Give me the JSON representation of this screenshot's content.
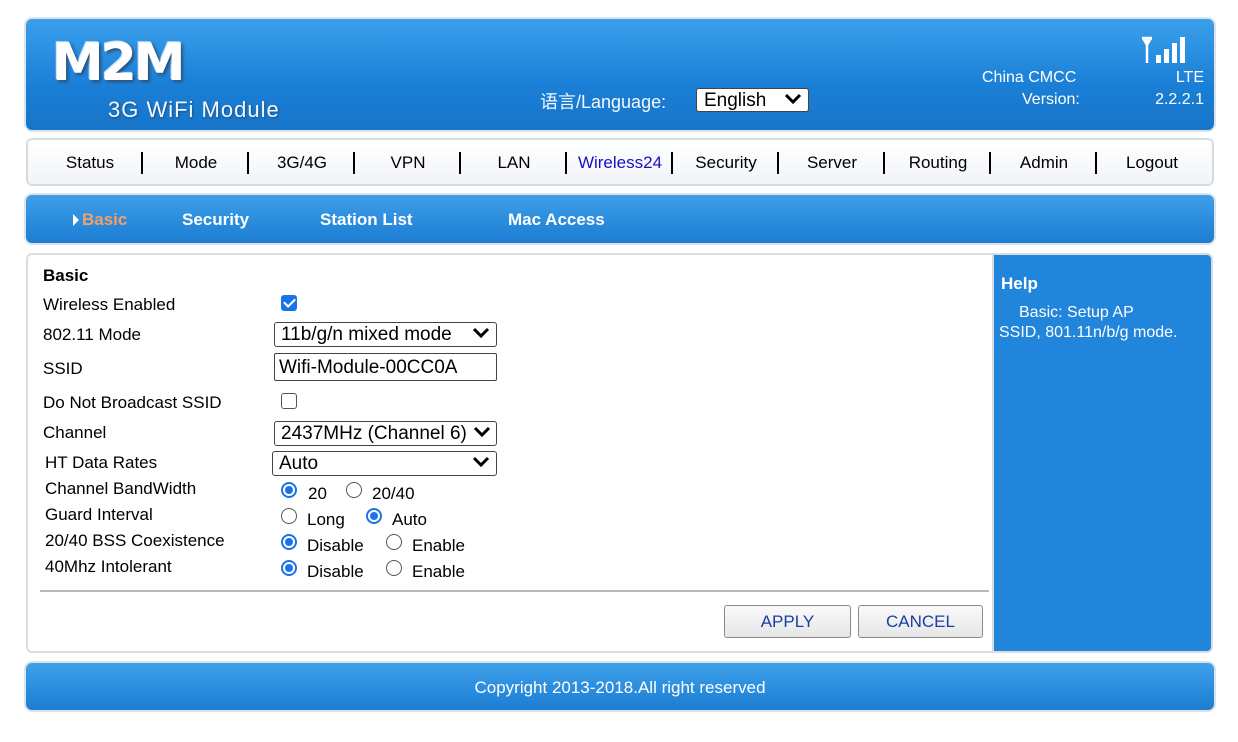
{
  "header": {
    "logo": "M2M",
    "subtitle": "3G WiFi Module",
    "language_label": "语言/Language:",
    "language_value": "English",
    "carrier": "China CMCC",
    "network": "LTE",
    "version_label": "Version:",
    "version_value": "2.2.2.1",
    "signal_icon": "signal-bars-icon"
  },
  "nav": {
    "items": [
      "Status",
      "Mode",
      "3G/4G",
      "VPN",
      "LAN",
      "Wireless24",
      "Security",
      "Server",
      "Routing",
      "Admin",
      "Logout"
    ],
    "active": "Wireless24"
  },
  "subnav": {
    "items": [
      "Basic",
      "Security",
      "Station List",
      "Mac Access"
    ],
    "active": "Basic"
  },
  "form": {
    "section_title": "Basic",
    "wireless_enabled": {
      "label": "Wireless Enabled",
      "checked": true
    },
    "mode": {
      "label": "802.11 Mode",
      "value": "11b/g/n mixed mode"
    },
    "ssid": {
      "label": "SSID",
      "value": "Wifi-Module-00CC0A"
    },
    "hide_ssid": {
      "label": "Do Not Broadcast SSID",
      "checked": false
    },
    "channel": {
      "label": "Channel",
      "value": "2437MHz (Channel 6)"
    },
    "ht_rates": {
      "label": "HT Data Rates",
      "value": "Auto"
    },
    "bandwidth": {
      "label": "Channel BandWidth",
      "options": [
        "20",
        "20/40"
      ],
      "selected": "20"
    },
    "guard": {
      "label": "Guard Interval",
      "options": [
        "Long",
        "Auto"
      ],
      "selected": "Auto"
    },
    "coexist": {
      "label": "20/40 BSS Coexistence",
      "options": [
        "Disable",
        "Enable"
      ],
      "selected": "Disable"
    },
    "intolerant": {
      "label": "40Mhz Intolerant",
      "options": [
        "Disable",
        "Enable"
      ],
      "selected": "Disable"
    }
  },
  "buttons": {
    "apply": "APPLY",
    "cancel": "CANCEL"
  },
  "help": {
    "title": "Help",
    "text": "Basic: Setup AP SSID, 801.11n/b/g mode."
  },
  "footer": {
    "text": "Copyright 2013-2018.All right reserved"
  },
  "colors": {
    "header_blue": "#1a7fd6",
    "active_nav": "#1a0fc4",
    "active_sub": "#f2a067",
    "radio_blue": "#1a73e8"
  }
}
